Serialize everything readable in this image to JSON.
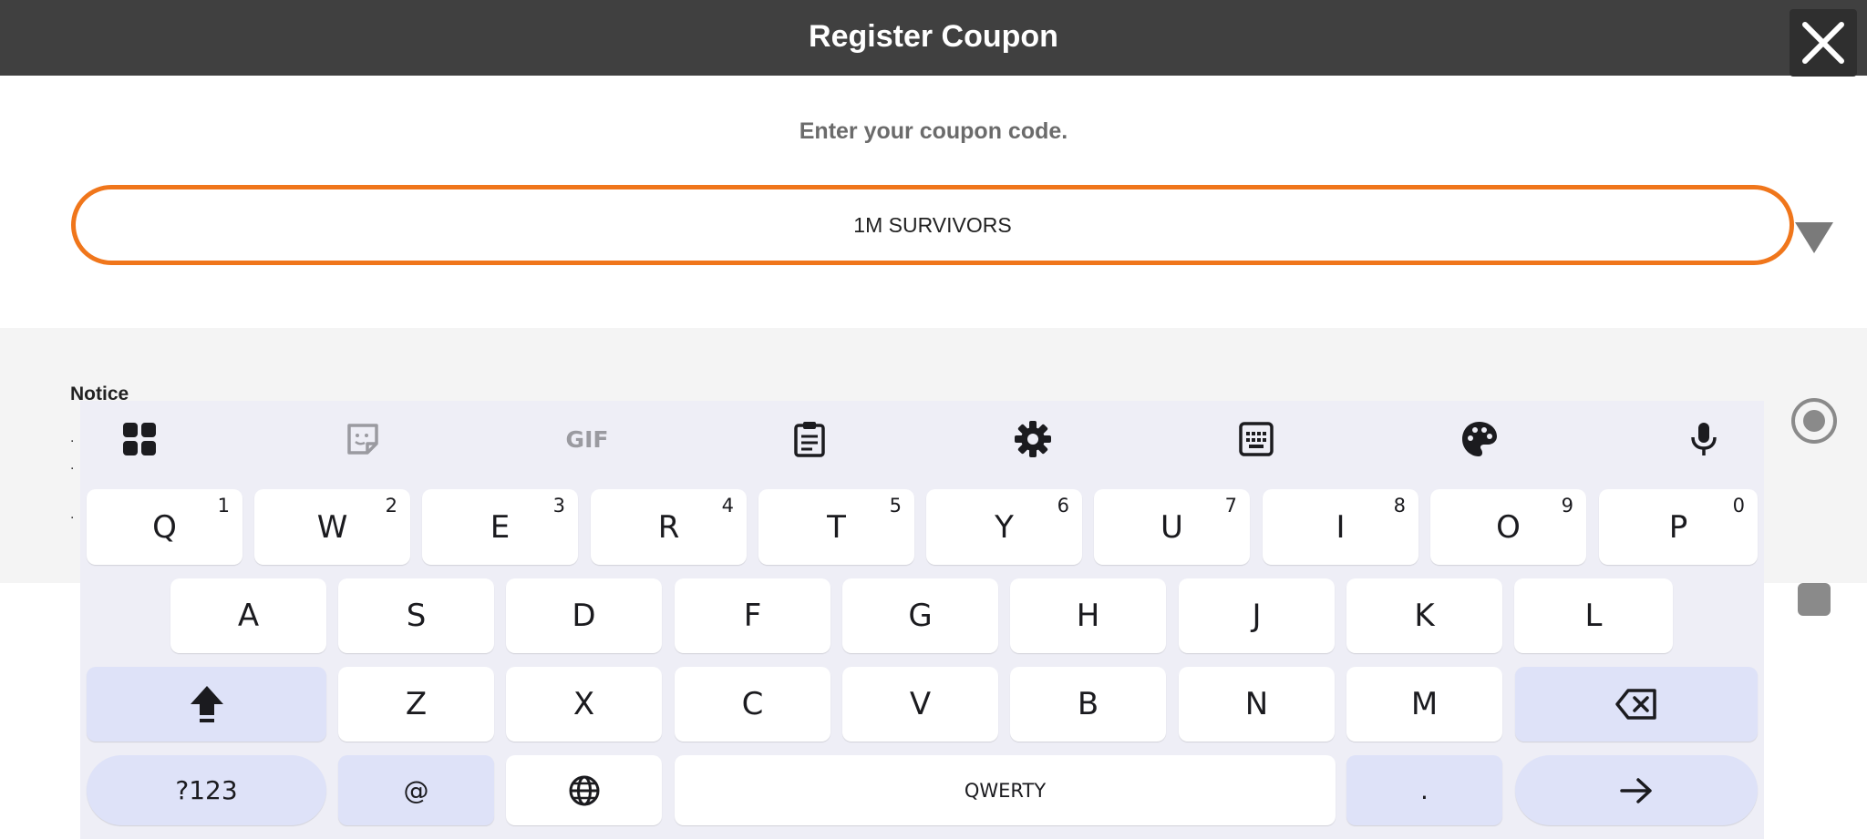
{
  "header": {
    "title": "Register Coupon",
    "close_icon": "close-icon"
  },
  "coupon": {
    "prompt": "Enter your coupon code.",
    "value": "1M SURVIVORS",
    "dropdown_icon": "triangle-down-icon"
  },
  "notice": {
    "title": "Notice",
    "bullets": [
      ".",
      ".",
      "."
    ]
  },
  "side_controls": {
    "record_icon": "record-icon",
    "stop_icon": "stop-icon"
  },
  "keyboard": {
    "toolbar": [
      "apps-grid-icon",
      "sticker-icon",
      "gif-icon",
      "clipboard-icon",
      "settings-gear-icon",
      "one-handed-keyboard-icon",
      "palette-icon",
      "microphone-icon"
    ],
    "gif_label": "GIF",
    "row1": [
      {
        "label": "Q",
        "hint": "1"
      },
      {
        "label": "W",
        "hint": "2"
      },
      {
        "label": "E",
        "hint": "3"
      },
      {
        "label": "R",
        "hint": "4"
      },
      {
        "label": "T",
        "hint": "5"
      },
      {
        "label": "Y",
        "hint": "6"
      },
      {
        "label": "U",
        "hint": "7"
      },
      {
        "label": "I",
        "hint": "8"
      },
      {
        "label": "O",
        "hint": "9"
      },
      {
        "label": "P",
        "hint": "0"
      }
    ],
    "row2": [
      "A",
      "S",
      "D",
      "F",
      "G",
      "H",
      "J",
      "K",
      "L"
    ],
    "row3": [
      "Z",
      "X",
      "C",
      "V",
      "B",
      "N",
      "M"
    ],
    "shift_icon": "shift-arrow-icon",
    "backspace_icon": "backspace-icon",
    "symbols_label": "?123",
    "at_label": "@",
    "globe_icon": "globe-icon",
    "space_label": "QWERTY",
    "period_label": ".",
    "enter_icon": "arrow-right-icon"
  },
  "colors": {
    "header_bg": "#404040",
    "accent": "#f0761b",
    "keyboard_bg": "#eeeef6",
    "modifier_key": "#dee2f8"
  }
}
